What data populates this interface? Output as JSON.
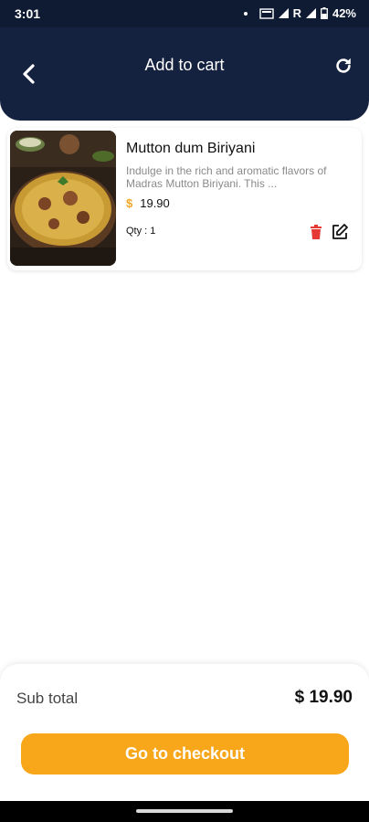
{
  "status_bar": {
    "time": "3:01",
    "battery": "42%",
    "roaming": "R"
  },
  "header": {
    "title": "Add to cart"
  },
  "cart": {
    "items": [
      {
        "name": "Mutton dum Biriyani",
        "description": "Indulge in the rich and aromatic flavors of Madras Mutton Biriyani. This ...",
        "currency_symbol": "$",
        "price": "19.90",
        "qty": "Qty : 1"
      }
    ]
  },
  "summary": {
    "subtotal_label": "Sub total",
    "subtotal_value": "$ 19.90"
  },
  "checkout": {
    "label": "Go to checkout"
  },
  "colors": {
    "header": "#14213f",
    "accent": "#f8a61a",
    "delete": "#e53935"
  }
}
